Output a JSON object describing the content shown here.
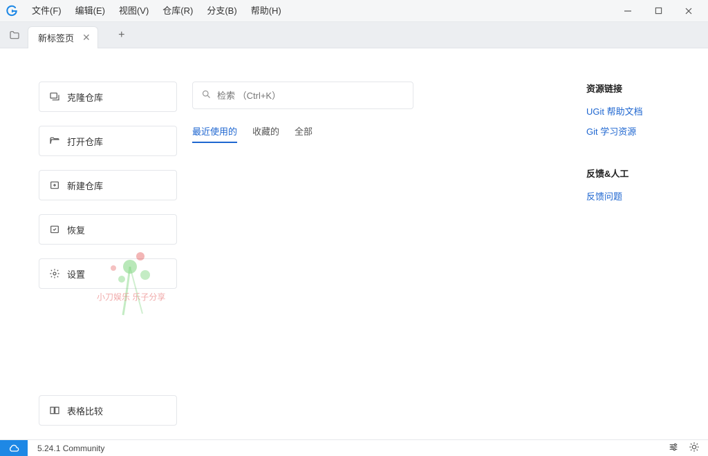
{
  "menubar": {
    "items": [
      "文件(F)",
      "编辑(E)",
      "视图(V)",
      "仓库(R)",
      "分支(B)",
      "帮助(H)"
    ]
  },
  "tabs": {
    "active": {
      "label": "新标签页"
    }
  },
  "actions": {
    "clone": "克隆仓库",
    "open": "打开仓库",
    "create": "新建仓库",
    "restore": "恢复",
    "settings": "设置",
    "table_compare": "表格比较"
  },
  "search": {
    "placeholder": "检索 （Ctrl+K）"
  },
  "center_tabs": {
    "recent": "最近使用的",
    "favorites": "收藏的",
    "all": "全部"
  },
  "right": {
    "resources_heading": "资源链接",
    "help_doc": "UGit 帮助文档",
    "learn": "Git 学习资源",
    "feedback_heading": "反馈&人工",
    "feedback_link": "反馈问题"
  },
  "status": {
    "version": "5.24.1 Community"
  },
  "watermark": {
    "text": "小刀娱乐 乐子分享"
  }
}
